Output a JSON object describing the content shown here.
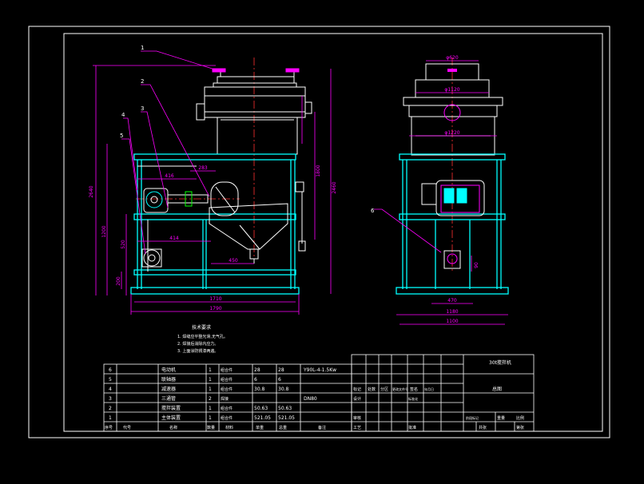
{
  "colors": {
    "background": "#000000",
    "frame": "#ffffff",
    "body": "#ffffff",
    "steel": "#00ffff",
    "dimension": "#ff00ff",
    "centerline": "#ff3030",
    "part": "#00ff00",
    "text": "#ffffff"
  },
  "callouts": [
    "1",
    "2",
    "3",
    "4",
    "5",
    "6"
  ],
  "front_view": {
    "dims": {
      "total_height": "2640",
      "height_2": "1800",
      "height_3": "2460",
      "height_4": "1200",
      "height_5": "520",
      "height_6": "200",
      "d_416": "416",
      "d_283": "283",
      "d_414": "414",
      "d_450": "450",
      "width_1710": "1710",
      "width_1790": "1790"
    }
  },
  "side_view": {
    "dims": {
      "top_1": "φ620",
      "top_2": "φ1120",
      "mid": "φ1220",
      "d_470": "470",
      "d_90": "90",
      "base_1": "1180",
      "base_2": "1100"
    }
  },
  "notes": {
    "title": "技术要求",
    "lines": [
      "1. 焊缝应平整光滑,无气孔。",
      "2. 焊接后消除内应力。",
      "3. 上面涂防锈漆两遍。"
    ]
  },
  "bom": {
    "rows": [
      {
        "no": "6",
        "name": "电动机",
        "qty": "1",
        "material": "组合件",
        "w1": "28",
        "w2": "28",
        "remark": "Y90L-4-1.5Kw"
      },
      {
        "no": "5",
        "name": "联轴器",
        "qty": "1",
        "material": "组合件",
        "w1": "6",
        "w2": "6",
        "remark": ""
      },
      {
        "no": "4",
        "name": "减速器",
        "qty": "1",
        "material": "组合件",
        "w1": "30.8",
        "w2": "30.8",
        "remark": ""
      },
      {
        "no": "3",
        "name": "三通管",
        "qty": "2",
        "material": "焊接",
        "w1": "",
        "w2": "",
        "remark": "DN80"
      },
      {
        "no": "2",
        "name": "搅拌装置",
        "qty": "1",
        "material": "组合件",
        "w1": "50.63",
        "w2": "50.63",
        "remark": ""
      },
      {
        "no": "1",
        "name": "主体装置",
        "qty": "1",
        "material": "组合件",
        "w1": "521.05",
        "w2": "521.05",
        "remark": ""
      }
    ],
    "header": [
      "序号",
      "代号",
      "名称",
      "数量",
      "材料",
      "单重",
      "总重",
      "备注"
    ]
  },
  "title_block": {
    "drawing_name": "30t搅拌机",
    "assembly": "总图",
    "labels": [
      "标记",
      "处数",
      "分区",
      "更改文件号",
      "签名",
      "年月日",
      "设计",
      "标准化",
      "阶段标记",
      "重量",
      "比例",
      "审核",
      "工艺",
      "批准",
      "共张",
      "第张"
    ]
  }
}
